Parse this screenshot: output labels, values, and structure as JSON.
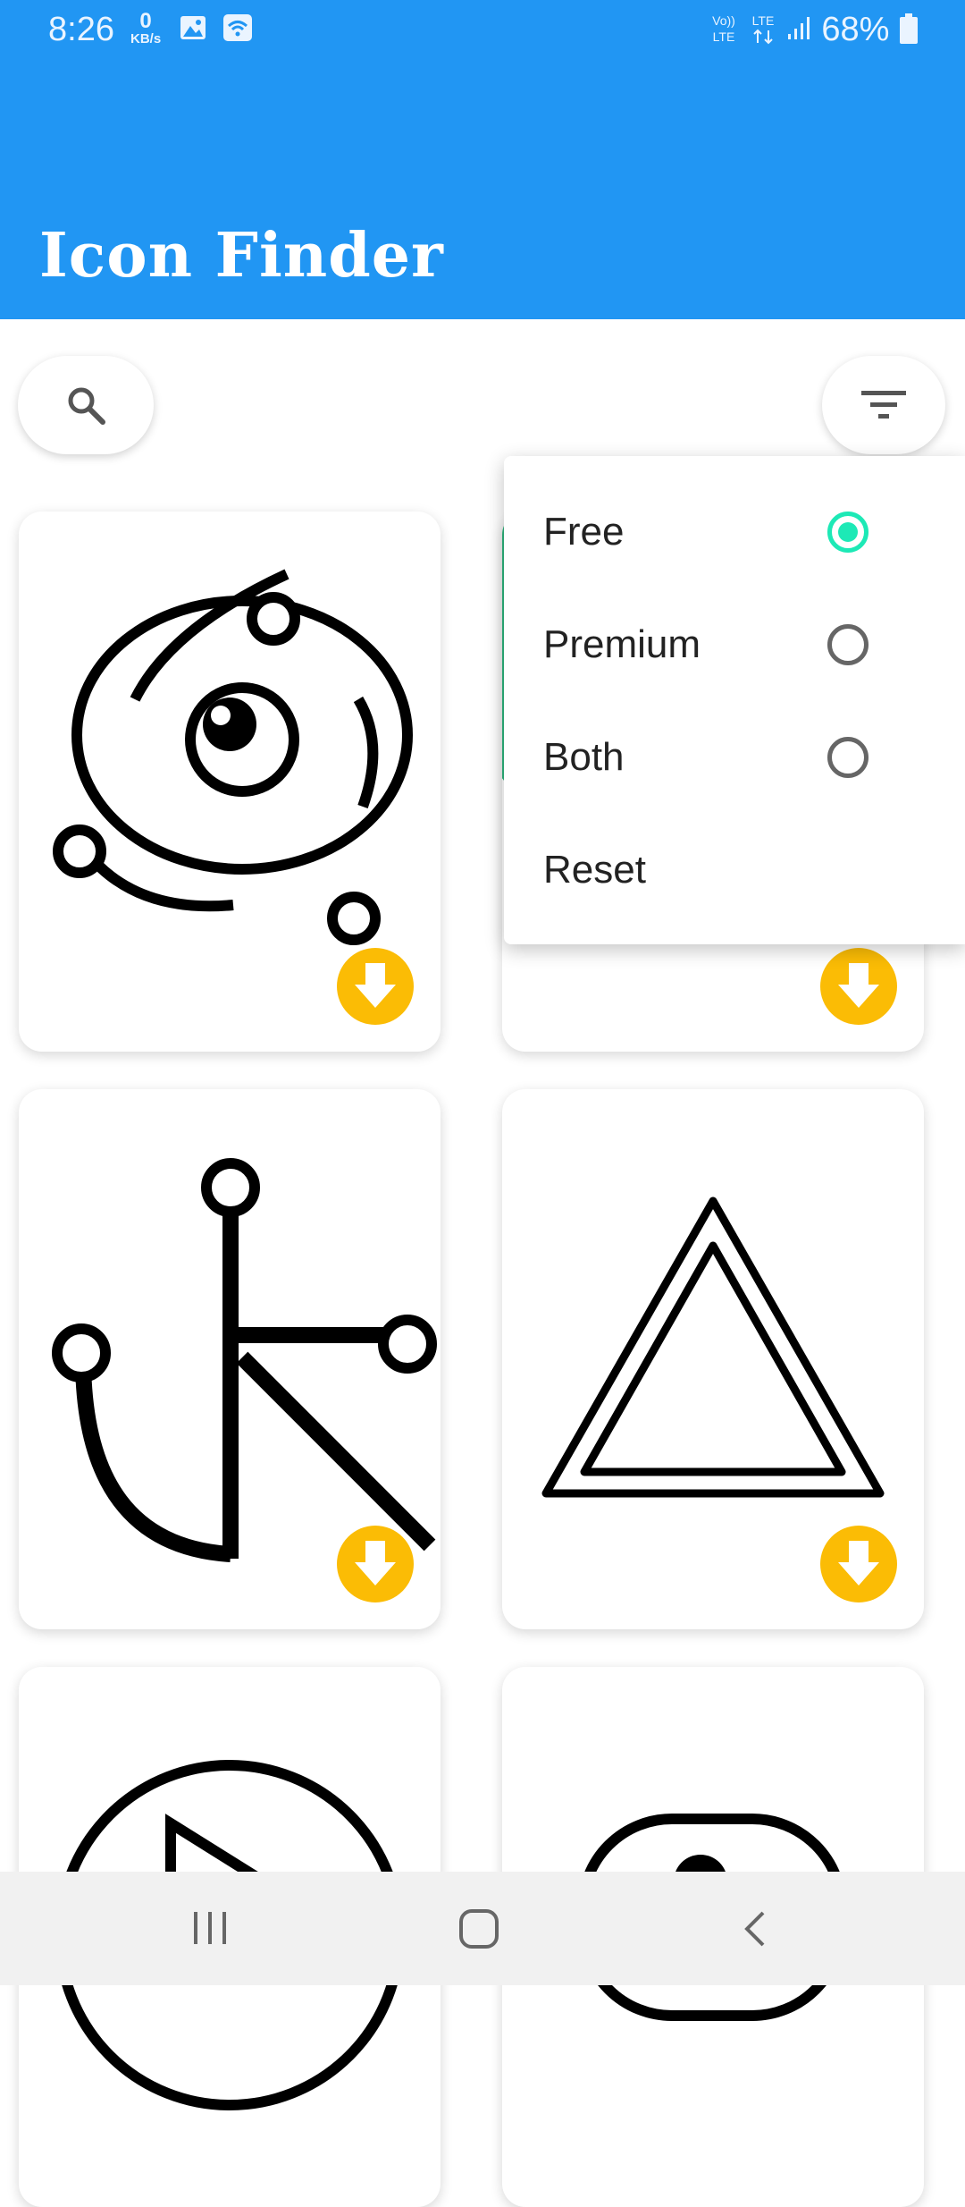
{
  "status_bar": {
    "time": "8:26",
    "data_speed_value": "0",
    "data_speed_unit": "KB/s",
    "battery": "68%"
  },
  "app_bar": {
    "title": "Icon Finder"
  },
  "filter_menu": {
    "options": [
      {
        "label": "Free",
        "checked": true
      },
      {
        "label": "Premium",
        "checked": false
      },
      {
        "label": "Both",
        "checked": false
      }
    ],
    "reset_label": "Reset"
  },
  "icons": [
    "circuit-eye-icon",
    "circle-icon",
    "circuit-k-icon",
    "double-triangle-icon",
    "play-circle-icon",
    "partial-icon"
  ],
  "colors": {
    "appbar": "#2196F3",
    "download": "#FBBC05",
    "radio_checked": "#1DE9B6"
  }
}
